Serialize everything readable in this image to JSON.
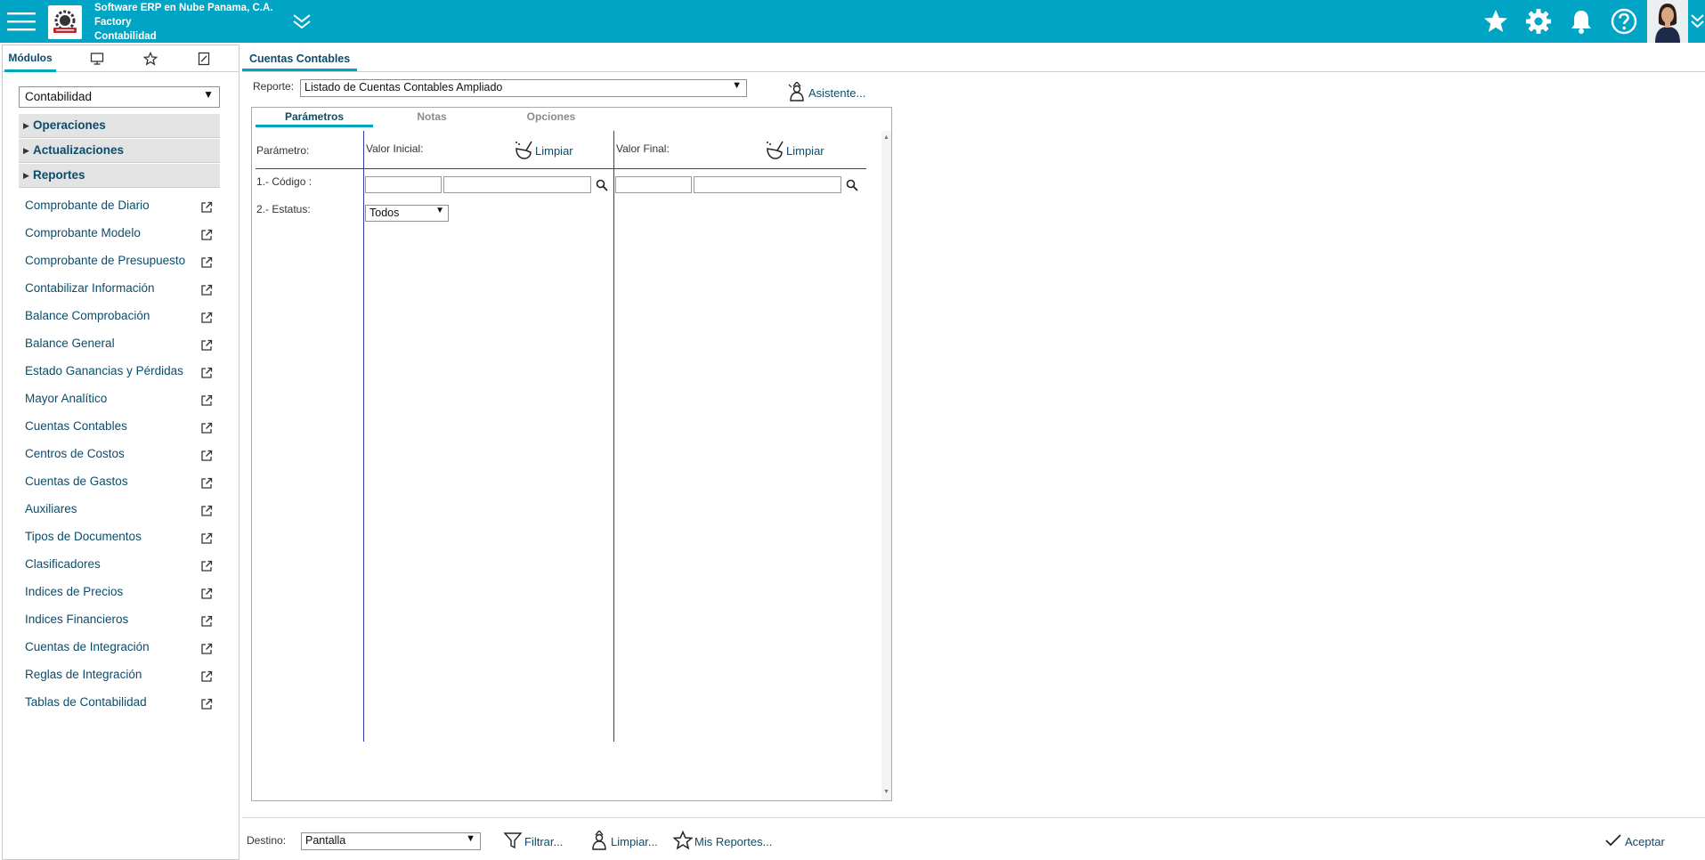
{
  "header": {
    "company_line1": "Software ERP en Nube Panama, C.A.",
    "company_line2": "Factory",
    "company_line3": "Contabilidad",
    "colors": {
      "bar": "#00a4c4",
      "accent": "#00a4c4",
      "link": "#0b4c6b"
    }
  },
  "left_tabs": {
    "modules": "Módulos"
  },
  "sidebar": {
    "module_selected": "Contabilidad",
    "sections": [
      {
        "label": "Operaciones"
      },
      {
        "label": "Actualizaciones"
      },
      {
        "label": "Reportes"
      }
    ],
    "items": [
      {
        "label": "Comprobante de Diario"
      },
      {
        "label": "Comprobante Modelo"
      },
      {
        "label": "Comprobante de Presupuesto"
      },
      {
        "label": "Contabilizar Información"
      },
      {
        "label": "Balance Comprobación"
      },
      {
        "label": "Balance General"
      },
      {
        "label": "Estado Ganancias y Pérdidas"
      },
      {
        "label": "Mayor Analítico"
      },
      {
        "label": "Cuentas Contables"
      },
      {
        "label": "Centros de Costos"
      },
      {
        "label": "Cuentas de Gastos"
      },
      {
        "label": "Auxiliares"
      },
      {
        "label": "Tipos de Documentos"
      },
      {
        "label": "Clasificadores"
      },
      {
        "label": "Indices de Precios"
      },
      {
        "label": "Indices Financieros"
      },
      {
        "label": "Cuentas de Integración"
      },
      {
        "label": "Reglas de Integración"
      },
      {
        "label": "Tablas de Contabilidad"
      }
    ]
  },
  "main": {
    "tab_title": "Cuentas Contables",
    "report_label": "Reporte:",
    "report_selected": "Listado de Cuentas Contables Ampliado",
    "wizard_label": "Asistente...",
    "param_tabs": [
      "Parámetros",
      "Notas",
      "Opciones"
    ],
    "param_header": "Parámetro:",
    "initial_header": "Valor Inicial:",
    "final_header": "Valor Final:",
    "clear_label": "Limpiar",
    "params": [
      {
        "label": "1.- Código :"
      },
      {
        "label": "2.- Estatus:",
        "selected": "Todos"
      }
    ]
  },
  "footer": {
    "dest_label": "Destino:",
    "dest_selected": "Pantalla",
    "filter_label": "Filtrar...",
    "clear_label": "Limpiar...",
    "my_reports_label": "Mis Reportes...",
    "accept_label": "Aceptar"
  }
}
